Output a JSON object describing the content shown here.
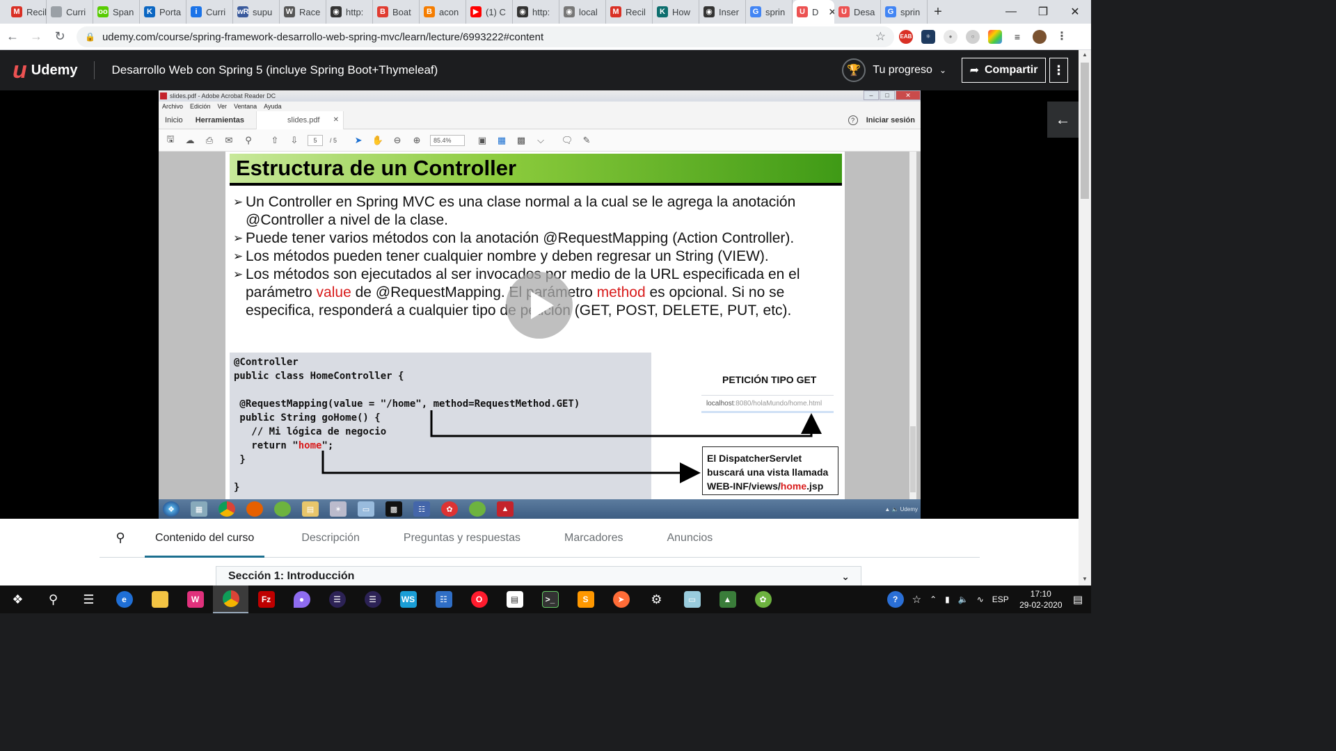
{
  "browser": {
    "tabs": [
      {
        "label": "Recil",
        "icon": "gmail-icon",
        "color": "#d93025",
        "glyph": "M"
      },
      {
        "label": "Curri",
        "icon": "page-icon",
        "color": "#9aa0a6",
        "glyph": ""
      },
      {
        "label": "Span",
        "icon": "duolingo-icon",
        "color": "#58cc02",
        "glyph": "oo"
      },
      {
        "label": "Porta",
        "icon": "k-icon",
        "color": "#0a66c2",
        "glyph": "K"
      },
      {
        "label": "Curri",
        "icon": "info-icon",
        "color": "#1a73e8",
        "glyph": "i"
      },
      {
        "label": "supu",
        "icon": "wordreference-icon",
        "color": "#3a5a9c",
        "glyph": "wR"
      },
      {
        "label": "Race",
        "icon": "wikipedia-icon",
        "color": "#555555",
        "glyph": "W"
      },
      {
        "label": "http:",
        "icon": "globe-icon",
        "color": "#333333",
        "glyph": "◉"
      },
      {
        "label": "Boat",
        "icon": "bootstrap-icon",
        "color": "#e03c31",
        "glyph": "B"
      },
      {
        "label": "acon",
        "icon": "blogger-icon",
        "color": "#f57d00",
        "glyph": "B"
      },
      {
        "label": "(1) C",
        "icon": "youtube-icon",
        "color": "#ff0000",
        "glyph": "▶"
      },
      {
        "label": "http:",
        "icon": "globe-icon",
        "color": "#333333",
        "glyph": "◉"
      },
      {
        "label": "local",
        "icon": "globe-icon",
        "color": "#777777",
        "glyph": "◉"
      },
      {
        "label": "Recil",
        "icon": "gmail-icon",
        "color": "#d93025",
        "glyph": "M"
      },
      {
        "label": "How",
        "icon": "k-icon",
        "color": "#0d6e6e",
        "glyph": "K"
      },
      {
        "label": "Inser",
        "icon": "globe-icon",
        "color": "#333333",
        "glyph": "◉"
      },
      {
        "label": "sprin",
        "icon": "google-icon",
        "color": "#4285f4",
        "glyph": "G"
      },
      {
        "label": "D",
        "icon": "udemy-icon",
        "color": "#ec5252",
        "glyph": "U",
        "active": true
      },
      {
        "label": "Desa",
        "icon": "udemy-icon",
        "color": "#ec5252",
        "glyph": "U"
      },
      {
        "label": "sprin",
        "icon": "google-icon",
        "color": "#4285f4",
        "glyph": "G"
      }
    ],
    "new_tab": "+",
    "url": "udemy.com/course/spring-framework-desarrollo-web-spring-mvc/learn/lecture/6993222#content"
  },
  "udemy": {
    "logo_text": "Udemy",
    "course_title": "Desarrollo Web con Spring 5 (incluye Spring Boot+Thymeleaf)",
    "progress_label": "Tu progreso",
    "share_label": "Compartir"
  },
  "acrobat": {
    "window_title": "slides.pdf - Adobe Acrobat Reader DC",
    "menu": [
      "Archivo",
      "Edición",
      "Ver",
      "Ventana",
      "Ayuda"
    ],
    "tab_home": "Inicio",
    "tab_tools": "Herramientas",
    "doc_tab": "slides.pdf",
    "sign_in": "Iniciar sesión",
    "page_current": "5",
    "page_total": "/ 5",
    "zoom": "85.4%"
  },
  "slide": {
    "title": "Estructura de un Controller",
    "bullets": [
      "Un Controller en Spring MVC es una clase normal a la cual se le agrega la anotación @Controller a nivel de la clase.",
      "Puede tener varios métodos con la anotación @RequestMapping (Action Controller).",
      "Los métodos pueden tener cualquier nombre y deben regresar un String (VIEW)."
    ],
    "b4_a": "Los métodos son ejecutados al ser invocados por medio de la URL especificada en el parámetro ",
    "b4_red1": "value",
    "b4_b": " de @RequestMapping. El parámetro ",
    "b4_red2": "method",
    "b4_c": " es opcional. Si no se especifica, responderá a cualquier tipo de petición (GET, POST, DELETE, PUT, etc).",
    "code": {
      "l1": "@Controller",
      "l2": "public class HomeController {",
      "l3": " @RequestMapping(value = \"/home\", method=RequestMethod.GET)",
      "l4": " public String goHome() {",
      "l5": "   // Mi lógica de negocio",
      "l6a": "   return \"",
      "l6red": "home",
      "l6b": "\";",
      "l7": " }",
      "l8": "}"
    },
    "get_title": "PETICIÓN TIPO GET",
    "get_url_host": "localhost",
    "get_url_rest": ":8080/holaMundo/home.html",
    "dispatcher_1": "El DispatcherServlet",
    "dispatcher_2": "buscará una vista llamada",
    "dispatcher_3a": "WEB-INF/views/",
    "dispatcher_3red": "home",
    "dispatcher_3b": ".jsp"
  },
  "course_tabs": {
    "items": [
      "Contenido del curso",
      "Descripción",
      "Preguntas y respuestas",
      "Marcadores",
      "Anuncios"
    ],
    "section": "Sección 1: Introducción"
  },
  "taskbar": {
    "lang": "ESP",
    "time": "17:10",
    "date": "29-02-2020"
  }
}
